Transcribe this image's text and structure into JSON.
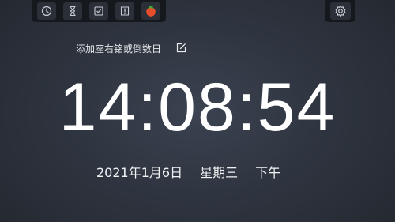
{
  "toolbar": {
    "icons": [
      "clock-icon",
      "hourglass-icon",
      "checklist-icon",
      "book-icon",
      "tomato-icon"
    ]
  },
  "settings": {
    "icon": "gear-icon"
  },
  "motto": {
    "text": "添加座右铭或倒数日",
    "edit_icon": "edit-icon"
  },
  "clock": {
    "time": "14:08:54",
    "date": "2021年1月6日",
    "weekday": "星期三",
    "period": "下午"
  },
  "colors": {
    "background": "#2f3540",
    "toolbar": "#15181d",
    "tomato": "#e74c2b"
  }
}
